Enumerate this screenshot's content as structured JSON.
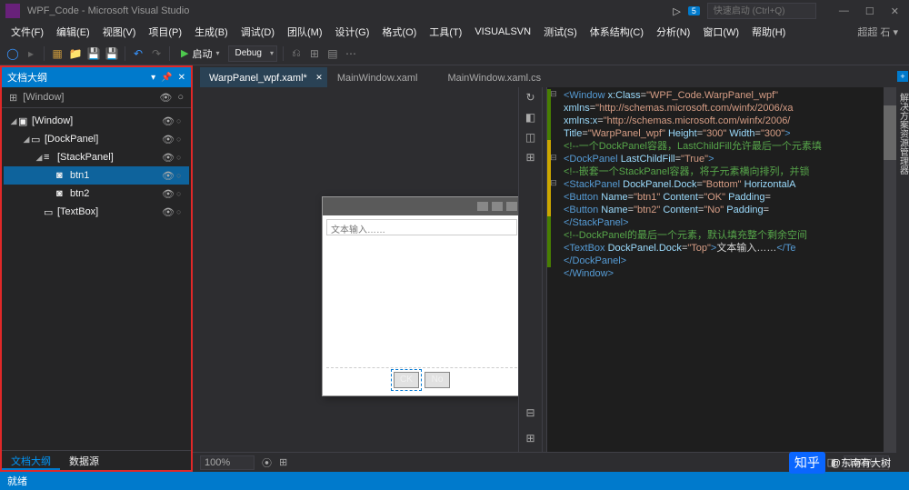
{
  "title": "WPF_Code - Microsoft Visual Studio",
  "quick_launch_placeholder": "快速启动 (Ctrl+Q)",
  "notify_count": "5",
  "menus": [
    "文件(F)",
    "编辑(E)",
    "视图(V)",
    "项目(P)",
    "生成(B)",
    "调试(D)",
    "团队(M)",
    "设计(G)",
    "格式(O)",
    "工具(T)",
    "VISUALSVN",
    "测试(S)",
    "体系结构(C)",
    "分析(N)",
    "窗口(W)",
    "帮助(H)"
  ],
  "user": "超超 石 ▾",
  "toolbar": {
    "start": "启动",
    "config": "Debug"
  },
  "outline": {
    "title": "文档大纲",
    "root_hint": "[Window]",
    "items": [
      {
        "indent": 0,
        "toggle": "◢",
        "icon": "▣",
        "label": "[Window]"
      },
      {
        "indent": 1,
        "toggle": "◢",
        "icon": "▭",
        "label": "[DockPanel]"
      },
      {
        "indent": 2,
        "toggle": "◢",
        "icon": "≡",
        "label": "[StackPanel]"
      },
      {
        "indent": 3,
        "toggle": "",
        "icon": "◙",
        "label": "btn1",
        "selected": true
      },
      {
        "indent": 3,
        "toggle": "",
        "icon": "◙",
        "label": "btn2"
      },
      {
        "indent": 2,
        "toggle": "",
        "icon": "▭",
        "label": "[TextBox]"
      }
    ],
    "tabs": [
      "文档大纲",
      "数据源"
    ]
  },
  "doc_tabs": [
    {
      "label": "WarpPanel_wpf.xaml*",
      "active": true
    },
    {
      "label": "MainWindow.xaml",
      "active": false
    },
    {
      "label": "MainWindow.xaml.cs",
      "active": false
    }
  ],
  "designer": {
    "textbox_placeholder": "文本输入……",
    "btn1": "CK",
    "btn2": "No"
  },
  "zoom": {
    "pct": "100%",
    "pct2": "100%"
  },
  "code": {
    "lines": [
      [
        {
          "t": "tag",
          "v": "<Window "
        },
        {
          "t": "attr",
          "v": "x:Class"
        },
        {
          "t": "eq",
          "v": "="
        },
        {
          "t": "str",
          "v": "\"WPF_Code.WarpPanel_wpf\""
        }
      ],
      [
        {
          "t": "txt",
          "v": "        "
        },
        {
          "t": "attr",
          "v": "xmlns"
        },
        {
          "t": "eq",
          "v": "="
        },
        {
          "t": "str",
          "v": "\"http://schemas.microsoft.com/winfx/2006/xa"
        }
      ],
      [
        {
          "t": "txt",
          "v": "        "
        },
        {
          "t": "attr",
          "v": "xmlns:x"
        },
        {
          "t": "eq",
          "v": "="
        },
        {
          "t": "str",
          "v": "\"http://schemas.microsoft.com/winfx/2006/"
        }
      ],
      [
        {
          "t": "txt",
          "v": "        "
        },
        {
          "t": "attr",
          "v": "Title"
        },
        {
          "t": "eq",
          "v": "="
        },
        {
          "t": "str",
          "v": "\"WarpPanel_wpf\""
        },
        {
          "t": "txt",
          "v": " "
        },
        {
          "t": "attr",
          "v": "Height"
        },
        {
          "t": "eq",
          "v": "="
        },
        {
          "t": "str",
          "v": "\"300\""
        },
        {
          "t": "txt",
          "v": " "
        },
        {
          "t": "attr",
          "v": "Width"
        },
        {
          "t": "eq",
          "v": "="
        },
        {
          "t": "str",
          "v": "\"300\""
        },
        {
          "t": "tag",
          "v": ">"
        }
      ],
      [
        {
          "t": "cmt",
          "v": "    <!--一个DockPanel容器，LastChildFill允许最后一个元素填"
        }
      ],
      [
        {
          "t": "txt",
          "v": "    "
        },
        {
          "t": "tag",
          "v": "<DockPanel "
        },
        {
          "t": "attr",
          "v": "LastChildFill"
        },
        {
          "t": "eq",
          "v": "="
        },
        {
          "t": "str",
          "v": "\"True\""
        },
        {
          "t": "tag",
          "v": ">"
        }
      ],
      [
        {
          "t": "cmt",
          "v": "        <!--嵌套一个StackPanel容器，将子元素横向排列，并锁"
        }
      ],
      [
        {
          "t": "txt",
          "v": "        "
        },
        {
          "t": "tag",
          "v": "<StackPanel "
        },
        {
          "t": "attr",
          "v": "DockPanel.Dock"
        },
        {
          "t": "eq",
          "v": "="
        },
        {
          "t": "str",
          "v": "\"Bottom\""
        },
        {
          "t": "txt",
          "v": " "
        },
        {
          "t": "attr",
          "v": "HorizontalA"
        }
      ],
      [
        {
          "t": "txt",
          "v": "            "
        },
        {
          "t": "tag",
          "v": "<Button "
        },
        {
          "t": "attr",
          "v": "Name"
        },
        {
          "t": "eq",
          "v": "="
        },
        {
          "t": "str",
          "v": "\"btn1\""
        },
        {
          "t": "txt",
          "v": " "
        },
        {
          "t": "attr",
          "v": "Content"
        },
        {
          "t": "eq",
          "v": "="
        },
        {
          "t": "str",
          "v": "\"OK\""
        },
        {
          "t": "txt",
          "v": " "
        },
        {
          "t": "attr",
          "v": "Padding"
        },
        {
          "t": "eq",
          "v": "="
        }
      ],
      [
        {
          "t": "txt",
          "v": "            "
        },
        {
          "t": "tag",
          "v": "<Button "
        },
        {
          "t": "attr",
          "v": "Name"
        },
        {
          "t": "eq",
          "v": "="
        },
        {
          "t": "str",
          "v": "\"btn2\""
        },
        {
          "t": "txt",
          "v": " "
        },
        {
          "t": "attr",
          "v": "Content"
        },
        {
          "t": "eq",
          "v": "="
        },
        {
          "t": "str",
          "v": "\"No\""
        },
        {
          "t": "txt",
          "v": " "
        },
        {
          "t": "attr",
          "v": "Padding"
        },
        {
          "t": "eq",
          "v": "="
        }
      ],
      [
        {
          "t": "txt",
          "v": "        "
        },
        {
          "t": "tag",
          "v": "</StackPanel>"
        }
      ],
      [
        {
          "t": "cmt",
          "v": "        <!--DockPanel的最后一个元素，默认填充整个剩余空间"
        }
      ],
      [
        {
          "t": "txt",
          "v": "        "
        },
        {
          "t": "tag",
          "v": "<TextBox "
        },
        {
          "t": "attr",
          "v": "DockPanel.Dock"
        },
        {
          "t": "eq",
          "v": "="
        },
        {
          "t": "str",
          "v": "\"Top\""
        },
        {
          "t": "tag",
          "v": ">"
        },
        {
          "t": "txt",
          "v": "文本输入……"
        },
        {
          "t": "tag",
          "v": "</Te"
        }
      ],
      [
        {
          "t": "txt",
          "v": "    "
        },
        {
          "t": "tag",
          "v": "</DockPanel>"
        }
      ],
      [
        {
          "t": "tag",
          "v": "</Window>"
        }
      ]
    ]
  },
  "status": "就绪",
  "watermark": {
    "logo": "知乎",
    "text": "@东南有大树"
  }
}
